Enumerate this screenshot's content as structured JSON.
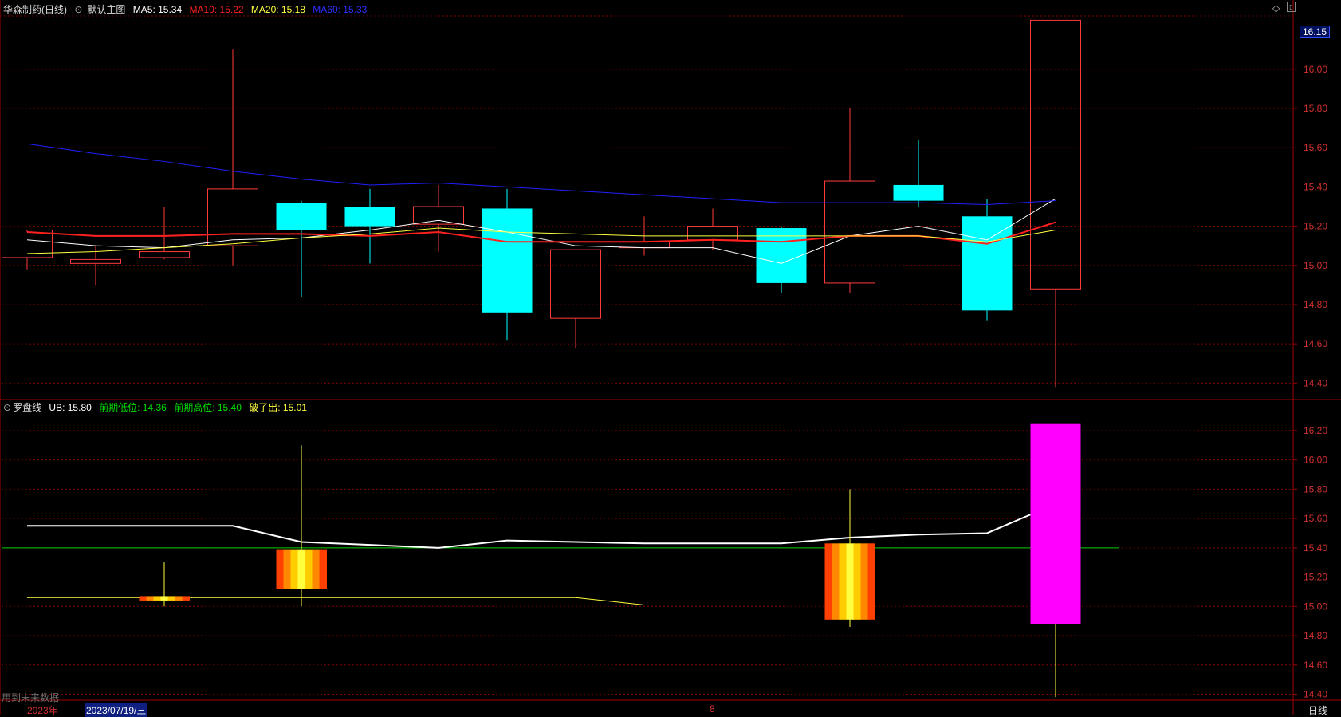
{
  "main_header": {
    "stock_name": "华森制药",
    "period": "(日线)",
    "chart_name": "默认主图",
    "ma5": "MA5: 15.34",
    "ma10": "MA10: 15.22",
    "ma20": "MA20: 15.18",
    "ma60": "MA60: 15.33"
  },
  "sub_header": {
    "indicator_name": "罗盘线",
    "ub": "UB: 15.80",
    "prev_low": "前期低位: 14.36",
    "prev_high": "前期高位: 15.40",
    "break_out": "破了出: 15.01"
  },
  "current_price_badge": "16.15",
  "period_label": "日线",
  "footer": {
    "future_data": "用到未来数据",
    "year": "2023年",
    "date": "2023/07/19/三",
    "month": "8"
  },
  "colors": {
    "up": "#ff3b3b",
    "down": "#00ffff",
    "ma5": "#ffffff",
    "ma10": "#ff2020",
    "ma20": "#ffff40",
    "ma60": "#2020ff",
    "magenta": "#ff00ff",
    "green": "#00d000",
    "grid": "#7a0000"
  },
  "chart_data": [
    {
      "type": "candlestick",
      "title": "华森制药 (日线)",
      "y_ticks": [
        "16.00",
        "15.80",
        "15.60",
        "15.40",
        "15.20",
        "15.00",
        "14.80",
        "14.60",
        "14.40"
      ],
      "ylim": [
        14.32,
        16.28
      ],
      "annotations": [
        {
          "label": "16.25",
          "candle_index": 20,
          "price": 16.25
        },
        {
          "label": "14.38",
          "candle_index": 20,
          "price": 14.38
        }
      ],
      "candles": [
        {
          "o": 15.04,
          "h": 15.17,
          "l": 14.98,
          "c": 15.18
        },
        {
          "o": 15.01,
          "h": 15.1,
          "l": 14.9,
          "c": 15.03
        },
        {
          "o": 15.04,
          "h": 15.3,
          "l": 15.03,
          "c": 15.07
        },
        {
          "o": 15.1,
          "h": 16.1,
          "l": 15.0,
          "c": 15.39
        },
        {
          "o": 15.32,
          "h": 15.33,
          "l": 14.84,
          "c": 15.18
        },
        {
          "o": 15.3,
          "h": 15.39,
          "l": 15.01,
          "c": 15.2
        },
        {
          "o": 15.21,
          "h": 15.41,
          "l": 15.07,
          "c": 15.3
        },
        {
          "o": 15.29,
          "h": 15.39,
          "l": 14.62,
          "c": 14.76
        },
        {
          "o": 14.73,
          "h": 15.08,
          "l": 14.58,
          "c": 15.08
        },
        {
          "o": 15.09,
          "h": 15.25,
          "l": 15.05,
          "c": 15.12
        },
        {
          "o": 15.13,
          "h": 15.29,
          "l": 15.08,
          "c": 15.2
        },
        {
          "o": 15.19,
          "h": 15.2,
          "l": 14.86,
          "c": 14.91
        },
        {
          "o": 14.91,
          "h": 15.8,
          "l": 14.86,
          "c": 15.43
        },
        {
          "o": 15.41,
          "h": 15.64,
          "l": 15.3,
          "c": 15.33
        },
        {
          "o": 15.25,
          "h": 15.34,
          "l": 14.72,
          "c": 14.77
        },
        {
          "o": 14.88,
          "h": 16.25,
          "l": 14.38,
          "c": 16.25
        }
      ],
      "ma_series": [
        {
          "name": "MA5",
          "values": [
            15.13,
            15.1,
            15.09,
            15.13,
            15.14,
            15.18,
            15.23,
            15.17,
            15.1,
            15.09,
            15.09,
            15.01,
            15.15,
            15.2,
            15.13,
            15.34
          ]
        },
        {
          "name": "MA10",
          "values": [
            15.17,
            15.15,
            15.15,
            15.16,
            15.16,
            15.15,
            15.17,
            15.12,
            15.12,
            15.12,
            15.13,
            15.12,
            15.15,
            15.15,
            15.11,
            15.22
          ]
        },
        {
          "name": "MA20",
          "values": [
            15.06,
            15.07,
            15.09,
            15.11,
            15.14,
            15.16,
            15.19,
            15.17,
            15.16,
            15.15,
            15.15,
            15.15,
            15.15,
            15.15,
            15.12,
            15.18
          ]
        },
        {
          "name": "MA60",
          "values": [
            15.62,
            15.57,
            15.53,
            15.48,
            15.44,
            15.41,
            15.42,
            15.4,
            15.38,
            15.36,
            15.34,
            15.32,
            15.32,
            15.32,
            15.31,
            15.33
          ]
        }
      ]
    },
    {
      "type": "indicator",
      "title": "罗盘线",
      "y_ticks": [
        "16.20",
        "16.00",
        "15.80",
        "15.60",
        "15.40",
        "15.20",
        "15.00",
        "14.80",
        "14.60",
        "14.40"
      ],
      "ylim": [
        14.37,
        16.33
      ],
      "ub_line": [
        15.55,
        15.55,
        15.55,
        15.55,
        15.44,
        15.42,
        15.4,
        15.45,
        15.44,
        15.43,
        15.43,
        15.43,
        15.47,
        15.49,
        15.5,
        15.7
      ],
      "prev_high_level": 15.4,
      "breakout_line": [
        15.06,
        15.06,
        15.06,
        15.06,
        15.06,
        15.06,
        15.06,
        15.06,
        15.06,
        15.01,
        15.01,
        15.01,
        15.01,
        15.01,
        15.01,
        15.01
      ],
      "signal_bars": [
        {
          "index": 2,
          "low": 15.04,
          "high": 15.07,
          "wick_low": 15.0,
          "wick_high": 15.3
        },
        {
          "index": 4,
          "low": 15.12,
          "high": 15.39,
          "wick_low": 15.0,
          "wick_high": 16.1
        },
        {
          "index": 12,
          "low": 14.91,
          "high": 15.43,
          "wick_low": 14.86,
          "wick_high": 15.8
        }
      ],
      "magenta_bar": {
        "index": 15,
        "low": 14.88,
        "high": 16.25,
        "wick_low": 14.38
      }
    }
  ]
}
